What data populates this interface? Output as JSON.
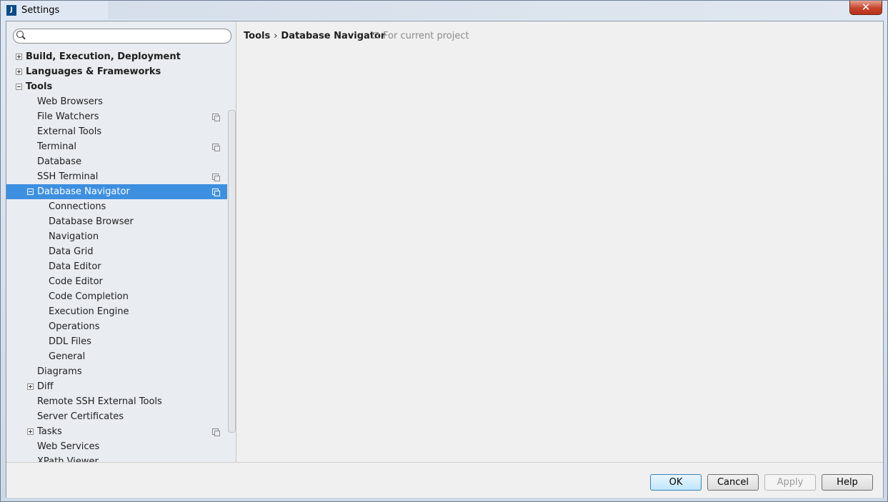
{
  "window": {
    "title": "Settings",
    "close_glyph": "✕",
    "app_icon_text": "J"
  },
  "search": {
    "value": "",
    "placeholder": ""
  },
  "tree": [
    {
      "label": "Build, Execution, Deployment",
      "level": 0,
      "expander": "plus",
      "project": false
    },
    {
      "label": "Languages & Frameworks",
      "level": 0,
      "expander": "plus",
      "project": false
    },
    {
      "label": "Tools",
      "level": 0,
      "expander": "minus",
      "project": false
    },
    {
      "label": "Web Browsers",
      "level": 1,
      "expander": "",
      "project": false
    },
    {
      "label": "File Watchers",
      "level": 1,
      "expander": "",
      "project": true
    },
    {
      "label": "External Tools",
      "level": 1,
      "expander": "",
      "project": false
    },
    {
      "label": "Terminal",
      "level": 1,
      "expander": "",
      "project": true
    },
    {
      "label": "Database",
      "level": 1,
      "expander": "",
      "project": false
    },
    {
      "label": "SSH Terminal",
      "level": 1,
      "expander": "",
      "project": true
    },
    {
      "label": "Database Navigator",
      "level": 1,
      "expander": "minus",
      "project": true,
      "selected": true
    },
    {
      "label": "Connections",
      "level": 2,
      "expander": "",
      "project": false
    },
    {
      "label": "Database Browser",
      "level": 2,
      "expander": "",
      "project": false
    },
    {
      "label": "Navigation",
      "level": 2,
      "expander": "",
      "project": false
    },
    {
      "label": "Data Grid",
      "level": 2,
      "expander": "",
      "project": false
    },
    {
      "label": "Data Editor",
      "level": 2,
      "expander": "",
      "project": false
    },
    {
      "label": "Code Editor",
      "level": 2,
      "expander": "",
      "project": false
    },
    {
      "label": "Code Completion",
      "level": 2,
      "expander": "",
      "project": false
    },
    {
      "label": "Execution Engine",
      "level": 2,
      "expander": "",
      "project": false
    },
    {
      "label": "Operations",
      "level": 2,
      "expander": "",
      "project": false
    },
    {
      "label": "DDL Files",
      "level": 2,
      "expander": "",
      "project": false
    },
    {
      "label": "General",
      "level": 2,
      "expander": "",
      "project": false
    },
    {
      "label": "Diagrams",
      "level": 1,
      "expander": "",
      "project": false
    },
    {
      "label": "Diff",
      "level": 1,
      "expander": "plus",
      "project": false
    },
    {
      "label": "Remote SSH External Tools",
      "level": 1,
      "expander": "",
      "project": false
    },
    {
      "label": "Server Certificates",
      "level": 1,
      "expander": "",
      "project": false
    },
    {
      "label": "Tasks",
      "level": 1,
      "expander": "plus",
      "project": true
    },
    {
      "label": "Web Services",
      "level": 1,
      "expander": "",
      "project": false
    },
    {
      "label": "XPath Viewer",
      "level": 1,
      "expander": "",
      "project": false
    }
  ],
  "breadcrumb": {
    "parent": "Tools",
    "separator": "›",
    "current": "Database Navigator"
  },
  "scope_label": "For current project",
  "buttons": {
    "ok": "OK",
    "cancel": "Cancel",
    "apply": "Apply",
    "help": "Help"
  }
}
